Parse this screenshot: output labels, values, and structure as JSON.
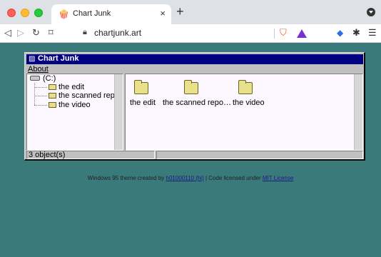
{
  "browser": {
    "tab_title": "Chart Junk",
    "tab_favicon": "🍿",
    "tab_close": "×",
    "new_tab": "+",
    "url": "chartjunk.art",
    "icons": [
      "back-icon",
      "forward-icon",
      "reload-icon",
      "bookmark-icon",
      "lock-icon",
      "brave-shield-icon",
      "bat-rewards-icon",
      "extension-icon",
      "puzzle-icon",
      "menu-icon"
    ]
  },
  "window": {
    "title": "Chart Junk",
    "menu": [
      "About"
    ],
    "tree": {
      "root": "(C:)",
      "items": [
        "the edit",
        "the scanned reposit",
        "the video"
      ]
    },
    "files": [
      {
        "label": "the edit"
      },
      {
        "label": "the scanned repo…"
      },
      {
        "label": "the video"
      }
    ],
    "status": "3 object(s)"
  },
  "footer": {
    "prefix": "Windows 95 theme created by ",
    "author_link": "h01000110 (hi)",
    "middle": " | Code licensed under ",
    "license_link": "MIT License"
  },
  "colors": {
    "desktop": "#3b7a7b",
    "titlebar": "#000080",
    "window": "#c0c0c0"
  }
}
